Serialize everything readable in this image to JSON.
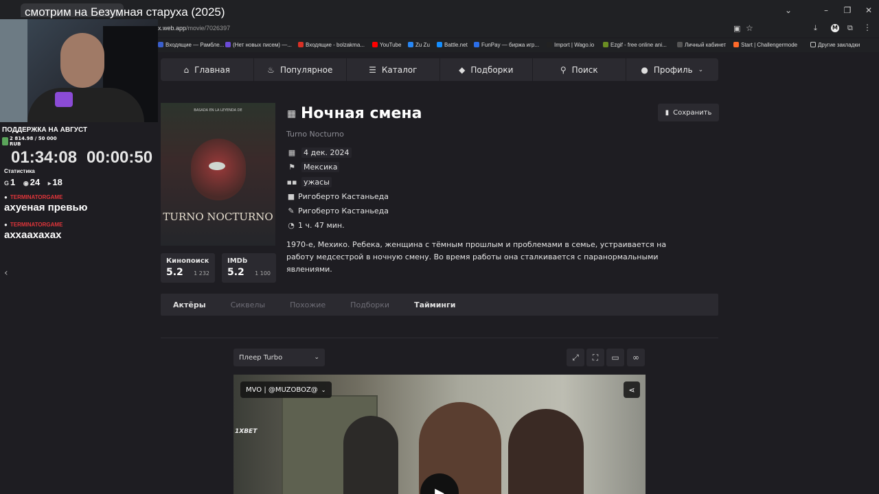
{
  "window": {
    "stream_title": "смотрим на Безумная старуха (2025)",
    "controls": [
      "⌄",
      "–",
      "❐",
      "✕"
    ]
  },
  "browser": {
    "url_host": "x.web.app",
    "url_path": "/movie/7026397",
    "bookmarks": [
      {
        "label": "Входящие — Рамбле...",
        "color": "#3a5fcd"
      },
      {
        "label": "(Нет новых писем) —...",
        "color": "#6b4bd6"
      },
      {
        "label": "Входящие - bolzakma...",
        "color": "#d93025"
      },
      {
        "label": "YouTube",
        "color": "#ff0000"
      },
      {
        "label": "Zu Zu",
        "color": "#2787f5"
      },
      {
        "label": "Battle.net",
        "color": "#148eff"
      },
      {
        "label": "FunPay — биржа игр...",
        "color": "#2b6ee8"
      },
      {
        "label": "Import | Wago.io",
        "color": "#222222"
      },
      {
        "label": "Ezgif - free online ani...",
        "color": "#6b8e23"
      },
      {
        "label": "Личный кабинет",
        "color": "#555555"
      },
      {
        "label": "Start | Challengermode",
        "color": "#ff6a2a"
      }
    ],
    "other_bookmarks": "Другие закладки"
  },
  "nav": [
    {
      "label": "Главная",
      "icon": "home-icon"
    },
    {
      "label": "Популярное",
      "icon": "fire-icon"
    },
    {
      "label": "Каталог",
      "icon": "stack-icon"
    },
    {
      "label": "Подборки",
      "icon": "shapes-icon"
    },
    {
      "label": "Поиск",
      "icon": "search-icon"
    },
    {
      "label": "Профиль",
      "icon": "user-icon"
    }
  ],
  "movie": {
    "title": "Ночная смена",
    "original_title": "Turno Nocturno",
    "save_label": "Сохранить",
    "release_date": "4 дек. 2024",
    "country": "Мексика",
    "genre": "ужасы",
    "director": "Ригоберто Кастаньеда",
    "writer": "Ригоберто Кастаньеда",
    "duration": "1 ч. 47 мин.",
    "description": "1970-е, Мехико. Ребека, женщина с тёмным прошлым и проблемами в семье, устраивается на работу медсестрой в ночную смену. Во время работы она сталкивается с паранормальными явлениями.",
    "poster_title": "TURNO NOCTURNO",
    "poster_tagline": "BASADA EN LA LEYENDA DE"
  },
  "ratings": [
    {
      "name": "Кинопоиск",
      "value": "5.2",
      "votes": "1 232"
    },
    {
      "name": "IMDb",
      "value": "5.2",
      "votes": "1 100"
    }
  ],
  "tabs": [
    "Актёры",
    "Сиквелы",
    "Похожие",
    "Подборки",
    "Тайминги"
  ],
  "player": {
    "select_label": "Плеер Turbo",
    "voice_label": "MVO | @MUZOBOZ@",
    "brand": "1XBET"
  },
  "stream_overlay": {
    "support_title": "ПОДДЕРЖКА НА АВГУСТ",
    "support_progress": "2 814.98 / 50 000 RUB",
    "support_fraction": 0.056,
    "timer_total": "01:34:08",
    "timer_segment": "00:00:50",
    "stats_label": "Статистика",
    "stat_1": "1",
    "stat_2": "24",
    "stat_3": "18",
    "chat": [
      {
        "user": "TERMINATORGAME",
        "message": "ахуеная превью"
      },
      {
        "user": "TERMINATORGAME",
        "message": "аххаахахах"
      }
    ]
  }
}
